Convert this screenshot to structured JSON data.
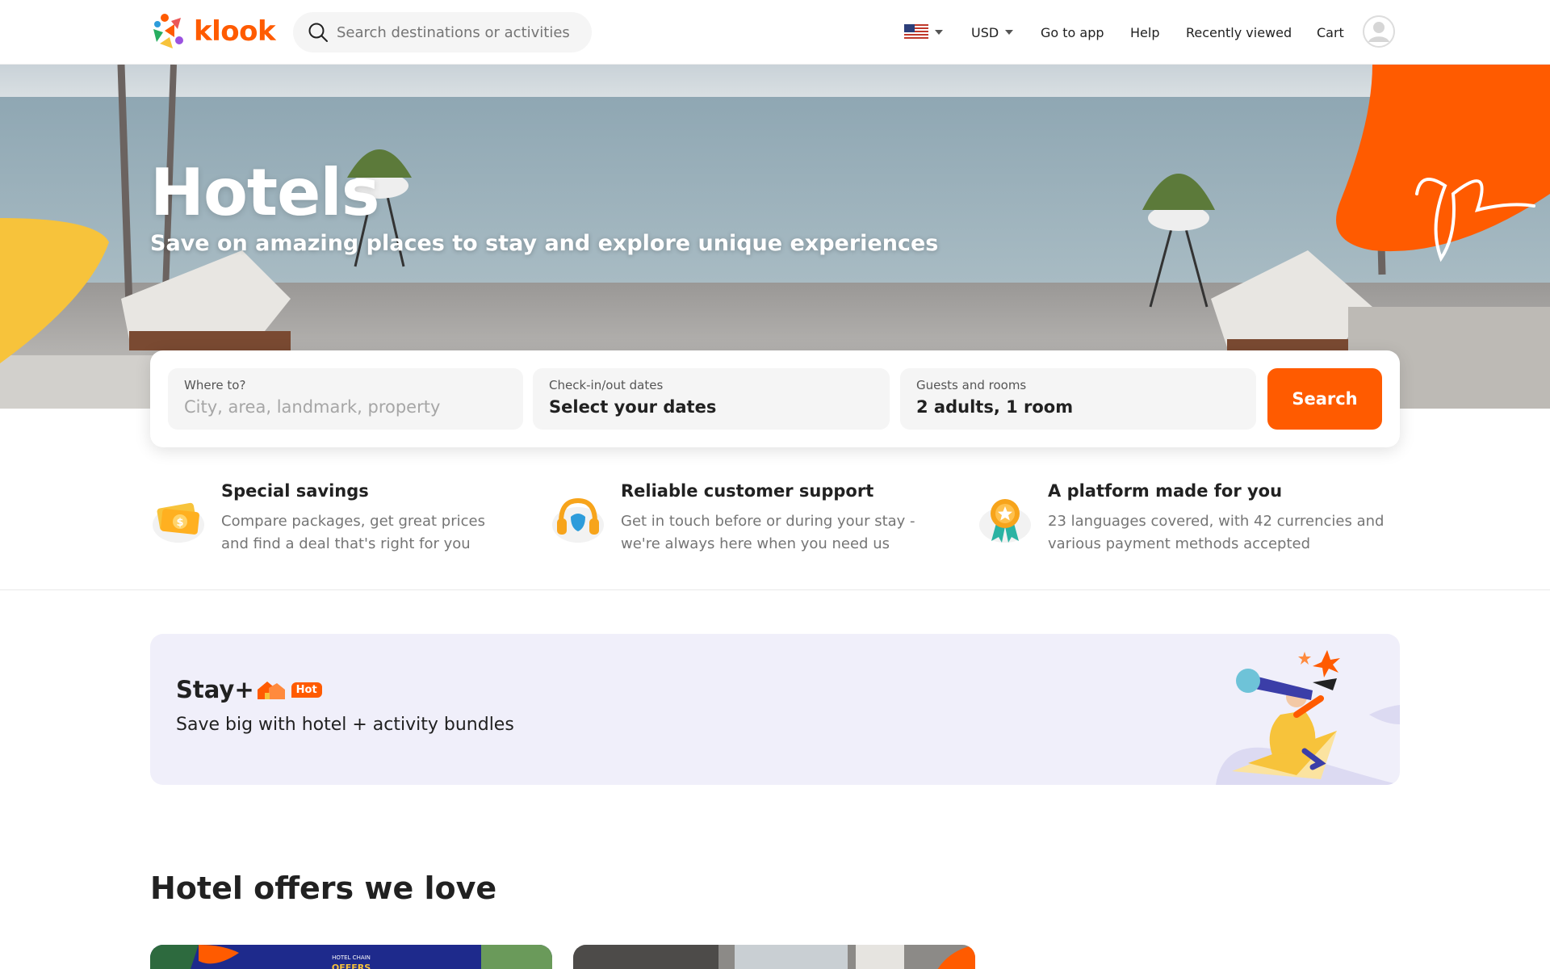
{
  "header": {
    "logo_text": "klook",
    "search_placeholder": "Search destinations or activities",
    "currency": "USD",
    "nav": {
      "go_to_app": "Go to app",
      "help": "Help",
      "recently_viewed": "Recently viewed",
      "cart": "Cart"
    }
  },
  "hero": {
    "title": "Hotels",
    "subtitle": "Save on amazing places to stay and explore unique experiences"
  },
  "booking": {
    "where_label": "Where to?",
    "where_placeholder": "City, area, landmark, property",
    "dates_label": "Check-in/out dates",
    "dates_value": "Select your dates",
    "guests_label": "Guests and rooms",
    "guests_value": "2 adults, 1 room",
    "search_label": "Search"
  },
  "features": [
    {
      "title": "Special savings",
      "line1": "Compare packages, get great prices",
      "line2": "and find a deal that's right for you"
    },
    {
      "title": "Reliable customer support",
      "line1": "Get in touch before or during your stay -",
      "line2": "we're always here when you need us"
    },
    {
      "title": "A platform made for you",
      "line1": "23 languages covered, with 42 currencies and",
      "line2": "various payment methods accepted"
    }
  ],
  "banner": {
    "brand": "Stay+",
    "badge": "Hot",
    "text": "Save big with hotel + activity bundles"
  },
  "offers": {
    "title": "Hotel offers we love",
    "card1_caption": "HOTEL CHAIN",
    "card1_text": "OFFERS"
  },
  "colors": {
    "accent": "#ff5b00",
    "yellow": "#f7c33b",
    "banner_bg": "#f0effa"
  }
}
